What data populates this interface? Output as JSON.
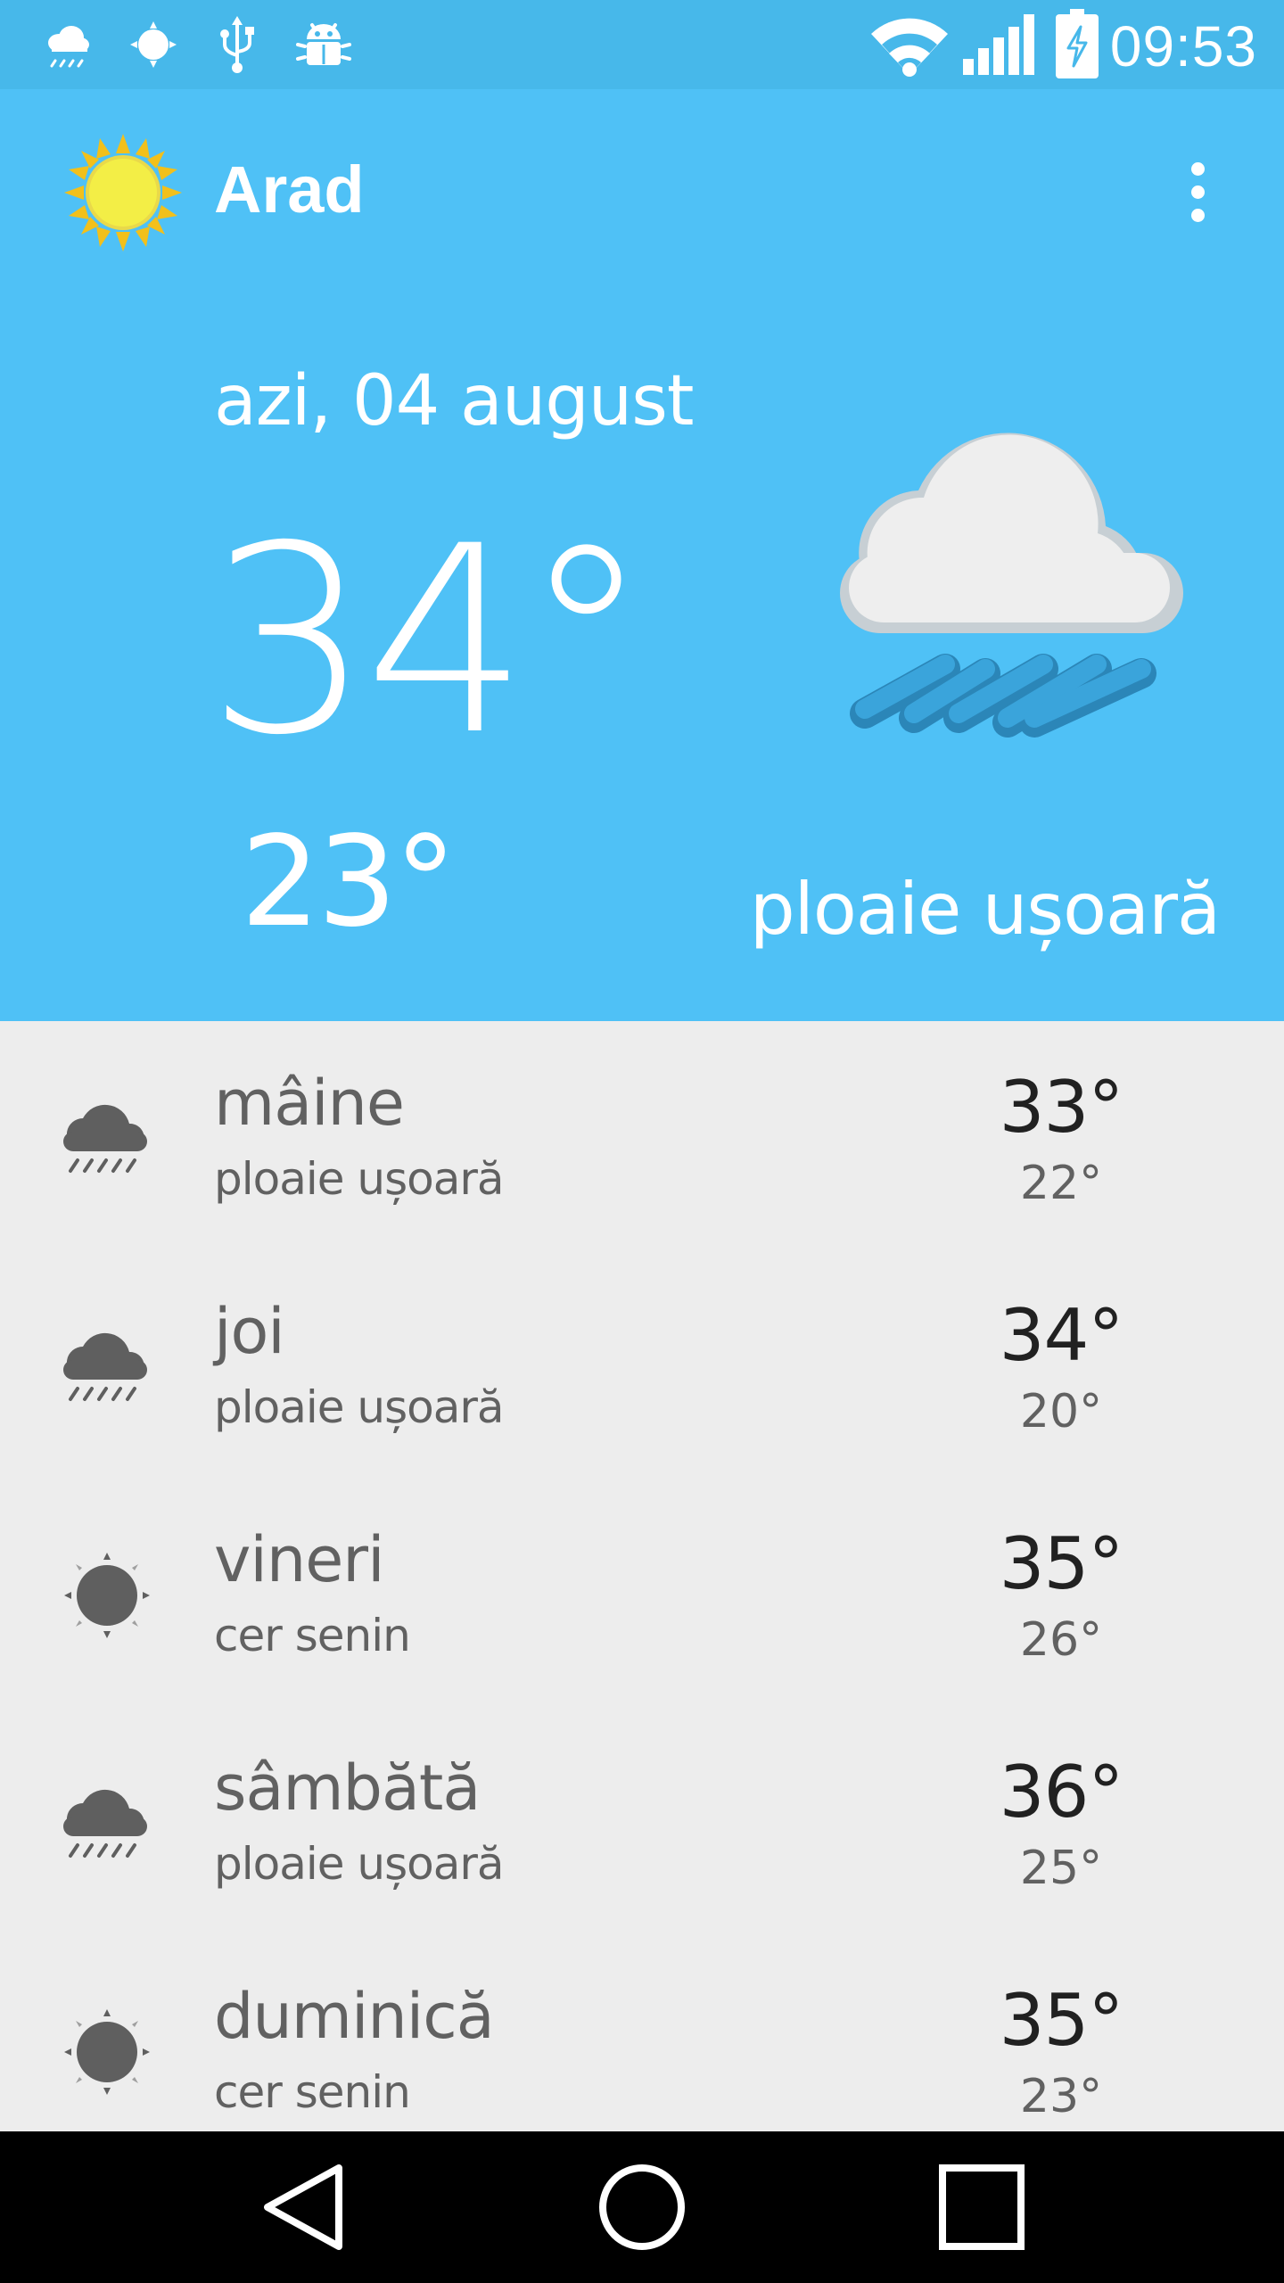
{
  "status_bar": {
    "time": "09:53",
    "left_icons": [
      "rain-cloud-icon",
      "sun-icon",
      "usb-icon",
      "android-debug-icon"
    ],
    "right_icons": [
      "wifi-icon",
      "signal-icon",
      "battery-charging-icon"
    ]
  },
  "app_bar": {
    "city": "Arad",
    "logo_icon": "sun-logo-icon",
    "menu_icon": "overflow-menu-icon"
  },
  "today": {
    "date": "azi, 04 august",
    "high": "34°",
    "low": "23°",
    "condition": "ploaie ușoară",
    "icon": "light-rain-icon"
  },
  "forecast": [
    {
      "day": "mâine",
      "condition": "ploaie ușoară",
      "high": "33°",
      "low": "22°",
      "icon": "rain-icon"
    },
    {
      "day": "joi",
      "condition": "ploaie ușoară",
      "high": "34°",
      "low": "20°",
      "icon": "rain-icon"
    },
    {
      "day": "vineri",
      "condition": "cer senin",
      "high": "35°",
      "low": "26°",
      "icon": "clear-sun-icon"
    },
    {
      "day": "sâmbătă",
      "condition": "ploaie ușoară",
      "high": "36°",
      "low": "25°",
      "icon": "rain-icon"
    },
    {
      "day": "duminică",
      "condition": "cer senin",
      "high": "35°",
      "low": "23°",
      "icon": "clear-sun-icon"
    }
  ],
  "nav_bar": {
    "buttons": [
      "back-icon",
      "home-icon",
      "recents-icon"
    ]
  },
  "colors": {
    "status_bar": "#47b8ea",
    "hero": "#4fc1f6",
    "list_bg": "#ededed",
    "icon_gray": "#5f5f5f"
  }
}
